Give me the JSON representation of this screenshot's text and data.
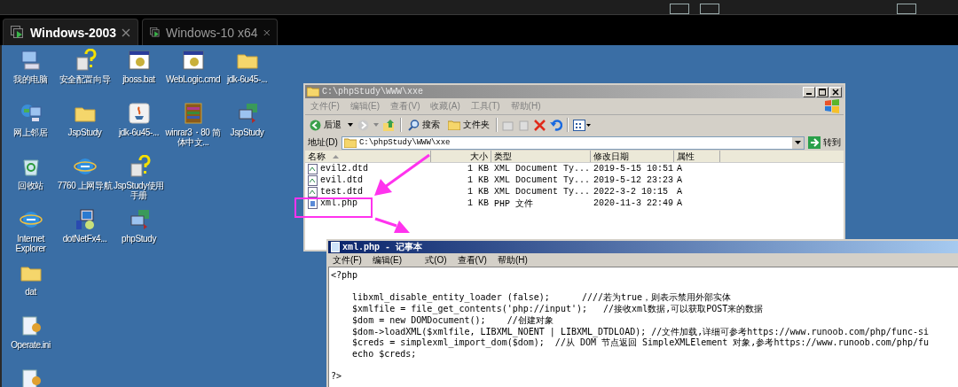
{
  "tabs": [
    {
      "label": "Windows-2003",
      "selected": true
    },
    {
      "label": "Windows-10 x64",
      "selected": false
    }
  ],
  "desktop": {
    "columns": [
      [
        {
          "label": "我的电脑",
          "kind": "computer"
        },
        {
          "label": "网上邻居",
          "kind": "network"
        },
        {
          "label": "回收站",
          "kind": "recycle"
        },
        {
          "label": "Internet Explorer",
          "kind": "ie"
        },
        {
          "label": "dat",
          "kind": "folder"
        },
        {
          "label": "Operate.ini",
          "kind": "ini"
        },
        {
          "kind": "ini"
        }
      ],
      [
        {
          "label": "安全配置向导",
          "kind": "help"
        },
        {
          "label": "JspStudy",
          "kind": "folder"
        },
        {
          "label": "7760 上网导航",
          "kind": "ie"
        },
        {
          "label": "dotNetFx4...",
          "kind": "setup"
        }
      ],
      [
        {
          "label": "jboss.bat",
          "kind": "batch"
        },
        {
          "label": "jdk-6u45-...",
          "kind": "java"
        },
        {
          "label": "JspStudy使用手册",
          "kind": "help"
        },
        {
          "label": "phpStudy",
          "kind": "study"
        }
      ],
      [
        {
          "label": "WebLogic.cmd",
          "kind": "batch"
        },
        {
          "label": "winrar3・80 简体中文...",
          "kind": "winrar"
        }
      ],
      [
        {
          "label": "jdk-6u45-...",
          "kind": "folder"
        },
        {
          "label": "JspStudy",
          "kind": "study"
        }
      ]
    ]
  },
  "explorer": {
    "title": "C:\\phpStudy\\WWW\\xxe",
    "menu": [
      "文件(F)",
      "编辑(E)",
      "查看(V)",
      "收藏(A)",
      "工具(T)",
      "帮助(H)"
    ],
    "toolbar": {
      "back": "后退",
      "search": "搜索",
      "folders": "文件夹"
    },
    "address": {
      "label": "地址(D)",
      "value": "C:\\phpStudy\\WWW\\xxe",
      "go": "转到"
    },
    "columns": [
      "名称",
      "大小",
      "类型",
      "修改日期",
      "属性"
    ],
    "files": [
      {
        "name": "evil2.dtd",
        "size": "1 KB",
        "type": "XML Document Ty...",
        "modified": "2019-5-15 10:51",
        "attributes": "A",
        "kind": "xml"
      },
      {
        "name": "evil.dtd",
        "size": "1 KB",
        "type": "XML Document Ty...",
        "modified": "2019-5-12 23:23",
        "attributes": "A",
        "kind": "xml"
      },
      {
        "name": "test.dtd",
        "size": "1 KB",
        "type": "XML Document Ty...",
        "modified": "2022-3-2 10:15",
        "attributes": "A",
        "kind": "xml"
      },
      {
        "name": "xml.php",
        "size": "1 KB",
        "type": "PHP 文件",
        "modified": "2020-11-3 22:49",
        "attributes": "A",
        "kind": "php"
      }
    ]
  },
  "notepad": {
    "title": "xml.php - 记事本",
    "menu": [
      "文件(F)",
      "编辑(E)",
      "式(O)",
      "查看(V)",
      "帮助(H)"
    ],
    "content": "<?php\n\n    libxml_disable_entity_loader (false);      ////若为true，则表示禁用外部实体\n    $xmlfile = file_get_contents('php://input');   //接收xml数据,可以获取POST来的数据\n    $dom = new DOMDocument();    //创建对象\n    $dom->loadXML($xmlfile, LIBXML_NOENT | LIBXML_DTDLOAD); //文件加载,详细可参考https://www.runoob.com/php/func-si\n    $creds = simplexml_import_dom($dom);  //从 DOM 节点返回 SimpleXMLElement 对象,参考https://www.runoob.com/php/fu\n    echo $creds;\n\n?>"
  }
}
